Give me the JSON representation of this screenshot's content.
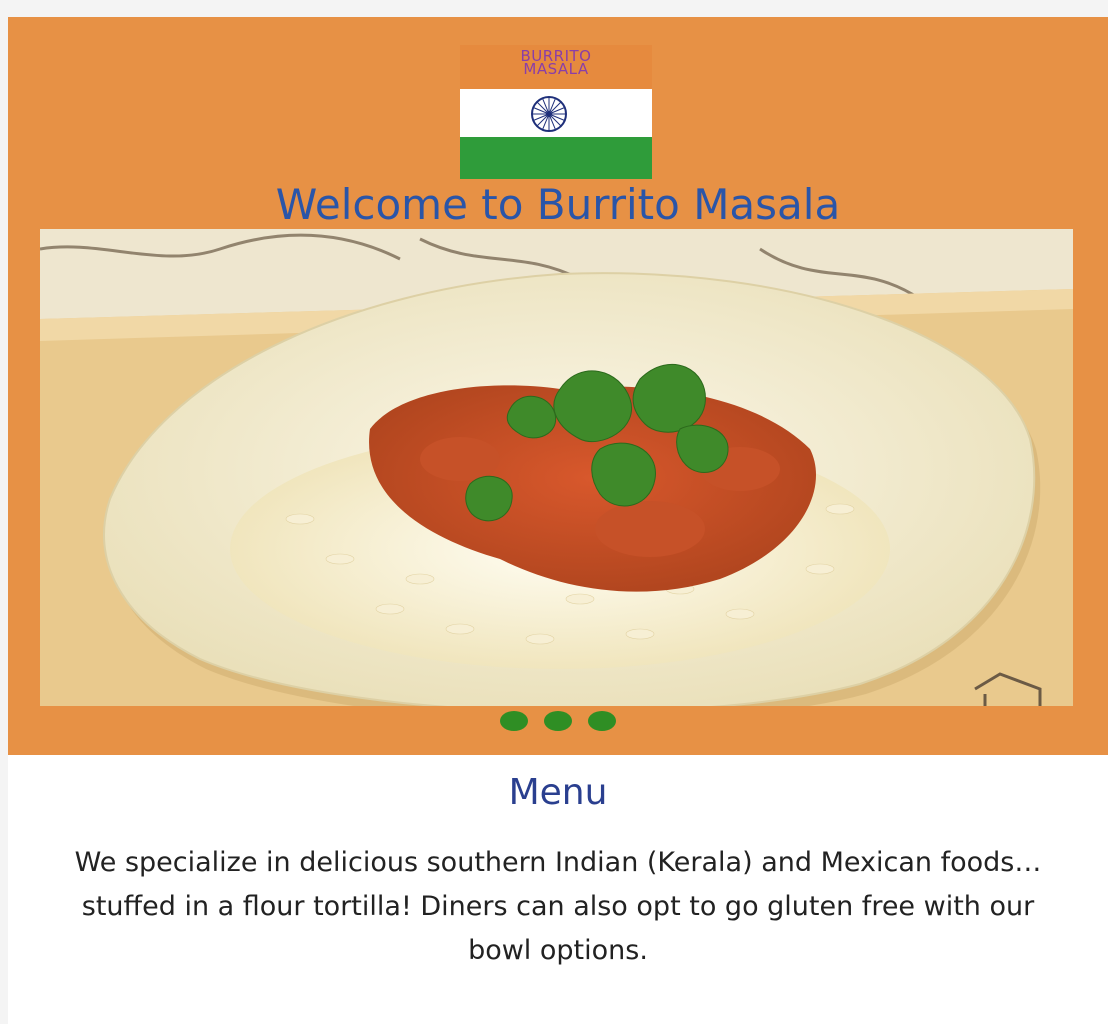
{
  "logo": {
    "line1": "BURRITO",
    "line2": "MASALA",
    "flag_colors": {
      "saffron": "#e68a3e",
      "white": "#ffffff",
      "green": "#2f9c3a",
      "chakra": "#1e2f7a"
    }
  },
  "hero": {
    "title": "Welcome to Burrito Masala",
    "background": "#e79145",
    "slide_count": 3
  },
  "menu": {
    "heading": "Menu",
    "description": "We specialize in delicious southern Indian (Kerala) and Mexican foods… stuffed in a flour tortilla! Diners can also opt to go gluten free with our bowl options."
  },
  "colors": {
    "heading_blue": "#2a55a8",
    "menu_heading": "#2a3f8f",
    "dot_green": "#2f8e24"
  }
}
